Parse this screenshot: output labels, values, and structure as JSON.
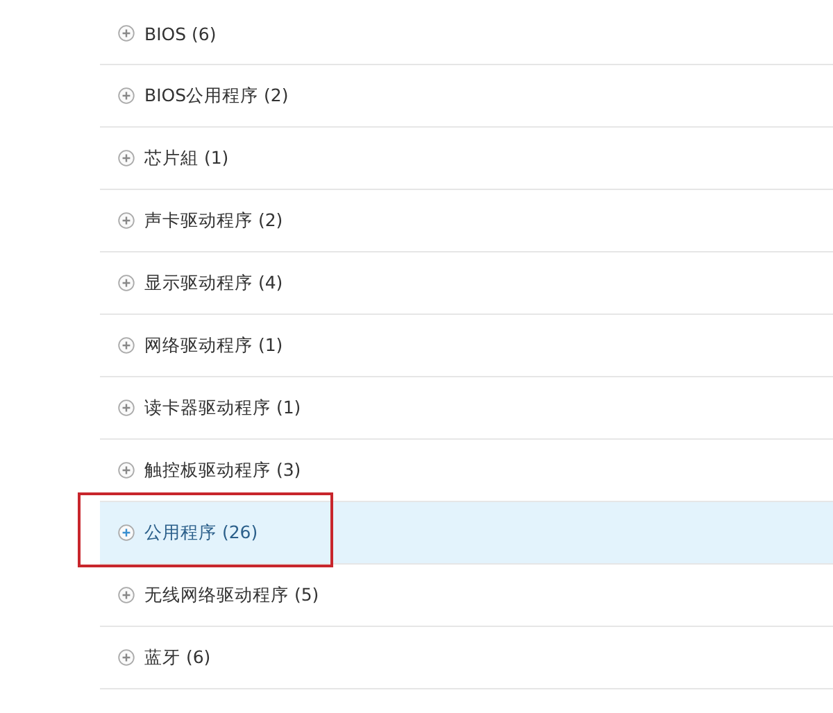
{
  "categories": [
    {
      "label": "BIOS (6)",
      "selected": false,
      "boxed": false
    },
    {
      "label": "BIOS公用程序 (2)",
      "selected": false,
      "boxed": false
    },
    {
      "label": "芯片組 (1)",
      "selected": false,
      "boxed": false
    },
    {
      "label": "声卡驱动程序 (2)",
      "selected": false,
      "boxed": false
    },
    {
      "label": "显示驱动程序 (4)",
      "selected": false,
      "boxed": false
    },
    {
      "label": "网络驱动程序 (1)",
      "selected": false,
      "boxed": false
    },
    {
      "label": "读卡器驱动程序 (1)",
      "selected": false,
      "boxed": false
    },
    {
      "label": "触控板驱动程序 (3)",
      "selected": false,
      "boxed": false
    },
    {
      "label": "公用程序 (26)",
      "selected": true,
      "boxed": true
    },
    {
      "label": "无线网络驱动程序 (5)",
      "selected": false,
      "boxed": false
    },
    {
      "label": "蓝牙 (6)",
      "selected": false,
      "boxed": false
    }
  ]
}
